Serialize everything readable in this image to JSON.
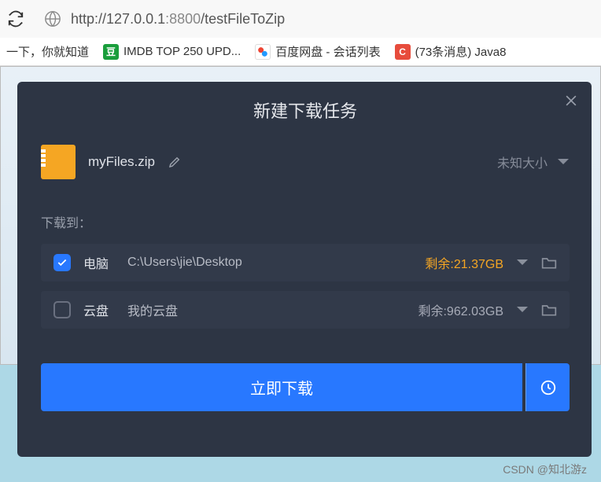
{
  "address_bar": {
    "url_prefix": "http://",
    "url_host": "127.0.0.1",
    "url_port": ":8800",
    "url_path": "/testFileToZip"
  },
  "bookmarks": {
    "item0": "一下，你就知道",
    "item1": "IMDB TOP 250 UPD...",
    "item2": "百度网盘 - 会话列表",
    "item3": "(73条消息) Java8"
  },
  "modal": {
    "title": "新建下载任务",
    "file_name": "myFiles.zip",
    "size_label": "未知大小",
    "download_to_label": "下载到：",
    "dest_computer": {
      "name": "电脑",
      "path": "C:\\Users\\jie\\Desktop",
      "remaining": "剩余:21.37GB"
    },
    "dest_cloud": {
      "name": "云盘",
      "path": "我的云盘",
      "remaining": "剩余:962.03GB"
    },
    "download_button": "立即下载"
  },
  "watermark": "CSDN @知北游z"
}
